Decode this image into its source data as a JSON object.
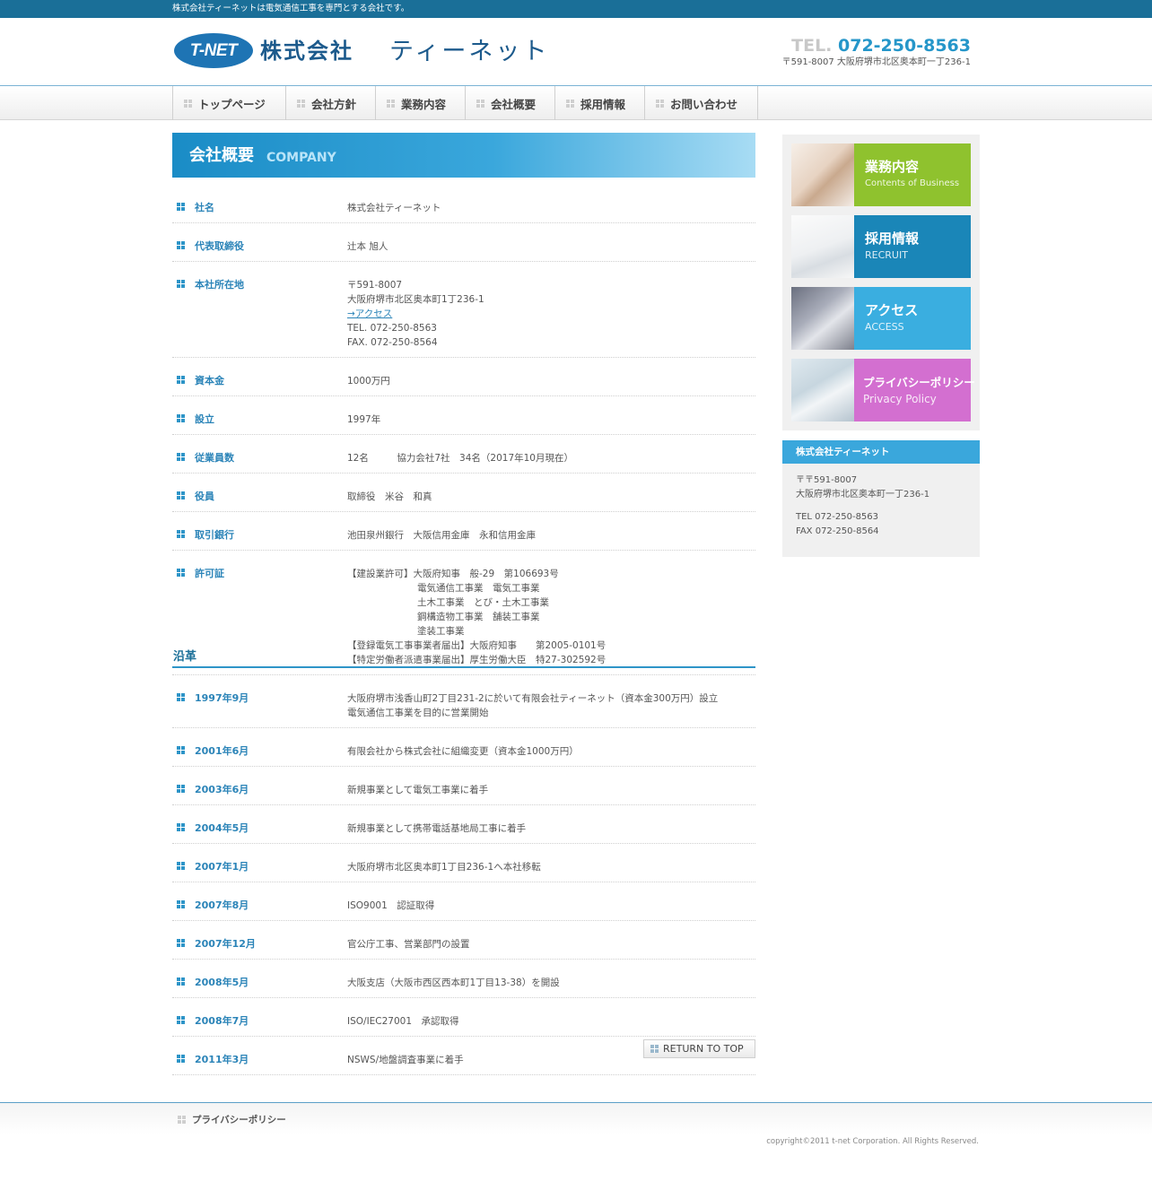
{
  "topbar": {
    "text": "株式会社ティーネットは電気通信工事を専門とする会社です。"
  },
  "header": {
    "logo_mark": "T-NET",
    "logo_company": "株式会社",
    "logo_name": "ティーネット",
    "tel_label": "TEL.",
    "tel_number": "072-250-8563",
    "address": "〒591-8007 大阪府堺市北区奥本町一丁236-1"
  },
  "nav": {
    "items": [
      "トップページ",
      "会社方針",
      "業務内容",
      "会社概要",
      "採用情報",
      "お問い合わせ"
    ]
  },
  "page_head": {
    "title_jp": "会社概要",
    "title_en": "COMPANY"
  },
  "company": {
    "rows": [
      {
        "label": "社名",
        "lines": [
          "株式会社ティーネット"
        ]
      },
      {
        "label": "代表取締役",
        "lines": [
          "辻本 旭人"
        ]
      },
      {
        "label": "本社所在地",
        "lines": [
          "〒591-8007",
          "大阪府堺市北区奥本町1丁236-1"
        ],
        "link": "→アクセス",
        "after": [
          "TEL. 072-250-8563",
          "FAX. 072-250-8564"
        ]
      },
      {
        "label": "資本金",
        "lines": [
          "1000万円"
        ]
      },
      {
        "label": "設立",
        "lines": [
          "1997年"
        ]
      },
      {
        "label": "従業員数",
        "lines": [
          "12名　　　協力会社7社　34名（2017年10月現在）"
        ]
      },
      {
        "label": "役員",
        "lines": [
          "取締役　米谷　和真"
        ]
      },
      {
        "label": "取引銀行",
        "lines": [
          "池田泉州銀行　大阪信用金庫　永和信用金庫"
        ]
      },
      {
        "label": "許可証",
        "lines": [
          "【建設業許可】大阪府知事　般-29　第106693号"
        ],
        "indented": [
          "電気通信工事業　電気工事業",
          "土木工事業　とび・土木工事業",
          "鋼構造物工事業　舗装工事業",
          "塗装工事業"
        ],
        "after": [
          "【登録電気工事事業者届出】大阪府知事　　第2005-0101号",
          "【特定労働者派遣事業届出】厚生労働大臣　特27-302592号"
        ]
      }
    ]
  },
  "history": {
    "title": "沿革",
    "rows": [
      {
        "label": "1997年9月",
        "lines": [
          "大阪府堺市浅香山町2丁目231-2に於いて有限会社ティーネット（資本金300万円）設立",
          "電気通信工事業を目的に営業開始"
        ]
      },
      {
        "label": "2001年6月",
        "lines": [
          "有限会社から株式会社に組織変更（資本金1000万円）"
        ]
      },
      {
        "label": "2003年6月",
        "lines": [
          "新規事業として電気工事業に着手"
        ]
      },
      {
        "label": "2004年5月",
        "lines": [
          "新規事業として携帯電話基地局工事に着手"
        ]
      },
      {
        "label": "2007年1月",
        "lines": [
          "大阪府堺市北区奥本町1丁目236-1へ本社移転"
        ]
      },
      {
        "label": "2007年8月",
        "lines": [
          "ISO9001　認証取得"
        ]
      },
      {
        "label": "2007年12月",
        "lines": [
          "官公庁工事、営業部門の設置"
        ]
      },
      {
        "label": "2008年5月",
        "lines": [
          "大阪支店（大阪市西区西本町1丁目13-38）を開設"
        ]
      },
      {
        "label": "2008年7月",
        "lines": [
          "ISO/IEC27001　承認取得"
        ]
      },
      {
        "label": "2011年3月",
        "lines": [
          "NSWS/地盤調査事業に着手"
        ]
      }
    ]
  },
  "return_top": "RETURN TO TOP",
  "sidebar": {
    "banners": [
      {
        "jp": "業務内容",
        "en": "Contents of Business",
        "color": "#8fc22e"
      },
      {
        "jp": "採用情報",
        "en": "RECRUIT",
        "color": "#1a86b8"
      },
      {
        "jp": "アクセス",
        "en": "ACCESS",
        "color": "#3aaee0"
      },
      {
        "jp": "プライバシーポリシー",
        "en": "Privacy Policy",
        "color": "#d36fd0"
      }
    ],
    "info": {
      "title": "株式会社ティーネット",
      "address1": "〒〒591-8007",
      "address2": "大阪府堺市北区奥本町一丁236-1",
      "tel": "TEL 072-250-8563",
      "fax": "FAX 072-250-8564"
    }
  },
  "footer": {
    "link": "プライバシーポリシー",
    "copyright": "copyright©2011 t-net Corporation. All Rights Reserved."
  }
}
